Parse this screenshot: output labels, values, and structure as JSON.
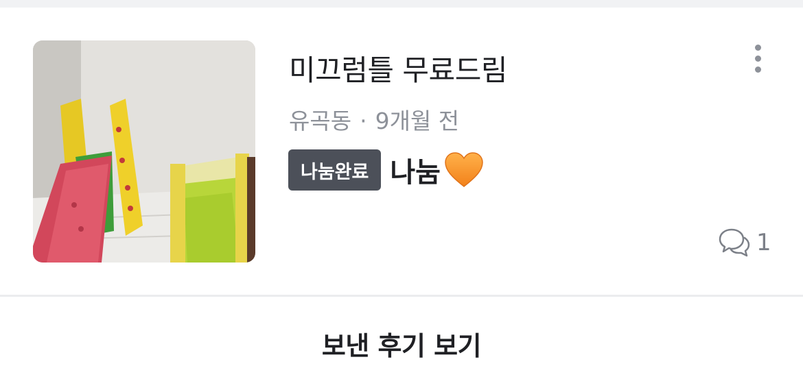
{
  "listing": {
    "title": "미끄럼틀 무료드림",
    "location": "유곡동",
    "separator": "·",
    "time_ago": "9개월 전",
    "status_badge": "나눔완료",
    "price": "나눔",
    "price_emoji": "orange-heart-icon",
    "chat_count": "1",
    "thumbnail_icon": "playground-slide-photo",
    "more_icon": "more-vertical-icon",
    "chat_icon": "chat-bubbles-icon"
  },
  "footer": {
    "review_label": "보낸 후기 보기"
  },
  "colors": {
    "badge_bg": "#4c5059",
    "text_primary": "#1f2024",
    "text_secondary": "#8d9199",
    "divider": "#ebecee",
    "top_strip": "#f1f2f4"
  }
}
